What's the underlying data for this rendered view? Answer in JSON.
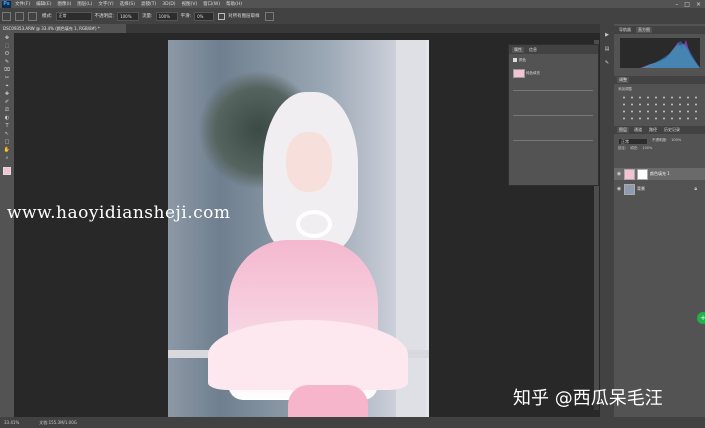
{
  "app": {
    "logo": "Ps",
    "menu": [
      "文件(F)",
      "编辑(E)",
      "图像(I)",
      "图层(L)",
      "文字(Y)",
      "选择(S)",
      "滤镜(T)",
      "3D(D)",
      "视图(V)",
      "窗口(W)",
      "帮助(H)"
    ],
    "window_controls": [
      "–",
      "□",
      "×"
    ]
  },
  "options_bar": {
    "mode_label": "模式:",
    "mode_value": "正常",
    "opacity_label": "不透明度:",
    "opacity_value": "100%",
    "flow_label": "流量:",
    "flow_value": "100%",
    "smooth_label": "平滑:",
    "smooth_value": "0%",
    "checkbox_label": "对所有图层取样"
  },
  "document": {
    "tab_title": "DSC09353.ARW @ 33.4% (颜色填充 1, RGB/8#) *",
    "status_zoom": "33.41%",
    "status_doc": "文档:155.3M/1.00G"
  },
  "tools": [
    "✥",
    "⬚",
    "ʘ",
    "✎",
    "⌧",
    "✂",
    "⌖",
    "✚",
    "✐",
    "⎚",
    "◐",
    "T",
    "↖",
    "□",
    "✋",
    "⌕"
  ],
  "panels": {
    "histogram_tabs": [
      "导航器",
      "直方图"
    ],
    "adjustments_tab": "调整",
    "adjustments_label": "添加调整",
    "layers_tabs": [
      "图层",
      "通道",
      "路径",
      "历史记录"
    ],
    "blend_mode": "正常",
    "opacity_label": "不透明度:",
    "opacity_value": "100%",
    "lock_label": "锁定:",
    "fill_label": "填充:",
    "fill_value": "100%",
    "layers": [
      {
        "name": "颜色填充 1",
        "visible": true,
        "selected": true
      },
      {
        "name": "背景",
        "visible": true,
        "selected": false
      }
    ],
    "properties_tabs": [
      "属性",
      "信息"
    ],
    "properties_title": "颜色",
    "properties_layer": "纯色填充"
  },
  "watermarks": {
    "url": "www.haoyidiansheji.com",
    "zhihu": "知乎 @西瓜呆毛汪"
  },
  "colors": {
    "pink_fill": "#f3c2d5",
    "zhihu_green": "#21b04b"
  }
}
